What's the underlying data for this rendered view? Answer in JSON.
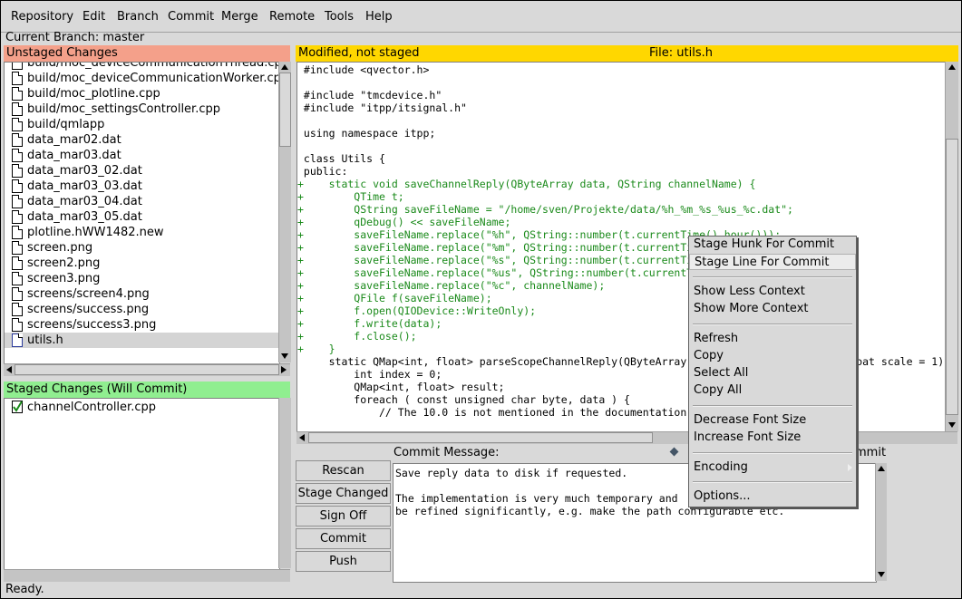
{
  "menu": [
    "Repository",
    "Edit",
    "Branch",
    "Commit",
    "Merge",
    "Remote",
    "Tools",
    "Help"
  ],
  "branch_line": "Current Branch: master",
  "unstaged": {
    "header": "Unstaged Changes",
    "header_color": "#f4a08a",
    "files": [
      "build/moc_deviceCommunicationThread.cpp",
      "build/moc_deviceCommunicationWorker.cpp",
      "build/moc_plotline.cpp",
      "build/moc_settingsController.cpp",
      "build/qmlapp",
      "data_mar02.dat",
      "data_mar03.dat",
      "data_mar03_02.dat",
      "data_mar03_03.dat",
      "data_mar03_04.dat",
      "data_mar03_05.dat",
      "plotline.hWW1482.new",
      "screen.png",
      "screen2.png",
      "screen3.png",
      "screens/screen4.png",
      "screens/success.png",
      "screens/success3.png",
      "utils.h"
    ],
    "selected": "utils.h"
  },
  "staged": {
    "header": "Staged Changes (Will Commit)",
    "header_color": "#90ee90",
    "files": [
      "channelController.cpp"
    ]
  },
  "diff": {
    "status": "Modified, not staged",
    "file_label": "File: utils.h",
    "header_color": "#ffd700",
    "lines": [
      {
        "t": " #include <qvector.h>",
        "add": false
      },
      {
        "t": "",
        "add": false
      },
      {
        "t": " #include \"tmcdevice.h\"",
        "add": false
      },
      {
        "t": " #include \"itpp/itsignal.h\"",
        "add": false
      },
      {
        "t": "",
        "add": false
      },
      {
        "t": " using namespace itpp;",
        "add": false
      },
      {
        "t": "",
        "add": false
      },
      {
        "t": " class Utils {",
        "add": false
      },
      {
        "t": " public:",
        "add": false
      },
      {
        "t": "+    static void saveChannelReply(QByteArray data, QString channelName) {",
        "add": true
      },
      {
        "t": "+        QTime t;",
        "add": true
      },
      {
        "t": "+        QString saveFileName = \"/home/sven/Projekte/data/%h_%m_%s_%us_%c.dat\";",
        "add": true
      },
      {
        "t": "+        qDebug() << saveFileName;",
        "add": true
      },
      {
        "t": "+        saveFileName.replace(\"%h\", QString::number(t.currentTime().hour()));",
        "add": true
      },
      {
        "t": "+        saveFileName.replace(\"%m\", QString::number(t.currentTime().minute()));",
        "add": true
      },
      {
        "t": "+        saveFileName.replace(\"%s\", QString::number(t.currentTime().second()));",
        "add": true
      },
      {
        "t": "+        saveFileName.replace(\"%us\", QString::number(t.currentTime().msec()));",
        "add": true
      },
      {
        "t": "+        saveFileName.replace(\"%c\", channelName);",
        "add": true
      },
      {
        "t": "+        QFile f(saveFileName);",
        "add": true
      },
      {
        "t": "+        f.open(QIODevice::WriteOnly);",
        "add": true
      },
      {
        "t": "+        f.write(data);",
        "add": true
      },
      {
        "t": "+        f.close();",
        "add": true
      },
      {
        "t": "+    }",
        "add": true
      },
      {
        "t": "     static QMap<int, float> parseScopeChannelReply(QByteArray data, float offset = 0, float scale = 1) {",
        "add": false
      },
      {
        "t": "         int index = 0;",
        "add": false
      },
      {
        "t": "         QMap<int, float> result;",
        "add": false
      },
      {
        "t": "         foreach ( const unsigned char byte, data ) {",
        "add": false
      },
      {
        "t": "             // The 10.0 is not mentioned in the documentation",
        "add": false
      }
    ]
  },
  "buttons": [
    "Rescan",
    "Stage Changed",
    "Sign Off",
    "Commit",
    "Push"
  ],
  "commit": {
    "label": "Commit Message:",
    "new_commit_fragment": "mmit",
    "message_lines": [
      "Save reply data to disk if requested.",
      "",
      "The implementation is very much temporary and",
      "be refined significantly, e.g. make the path configurable etc."
    ]
  },
  "context_menu": {
    "items": [
      "Stage Hunk For Commit",
      "Stage Line For Commit",
      "Show Less Context",
      "Show More Context",
      "Refresh",
      "Copy",
      "Select All",
      "Copy All",
      "Decrease Font Size",
      "Increase Font Size",
      "Encoding",
      "Options..."
    ],
    "highlighted": "Stage Line For Commit"
  },
  "status": "Ready."
}
